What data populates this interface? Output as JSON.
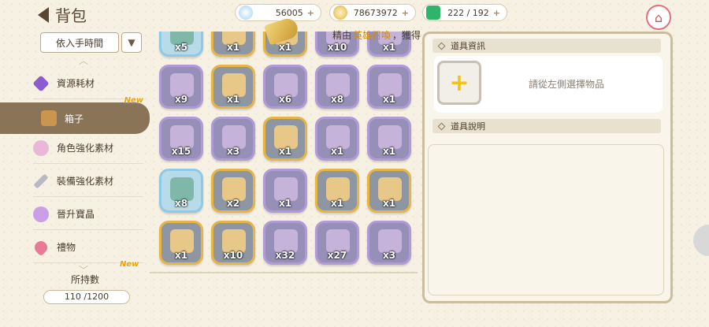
{
  "header": {
    "title": "背包"
  },
  "currencies": [
    {
      "icon": "gem-icon",
      "value": "56005"
    },
    {
      "icon": "coin-icon",
      "value": "78673972"
    },
    {
      "icon": "stamina-icon",
      "value": "222 / 192"
    }
  ],
  "sort": {
    "label": "依入手時間"
  },
  "sidebar": {
    "items": [
      {
        "label": "資源耗材",
        "icon": "crystal-icon",
        "color": "#8b5bd0"
      },
      {
        "label": "箱子",
        "icon": "box-icon",
        "color": "#c9954f",
        "badge": "New"
      },
      {
        "label": "角色強化素材",
        "icon": "character-material-icon",
        "color": "#e9b8d8"
      },
      {
        "label": "裝備強化素材",
        "icon": "sword-icon",
        "color": "#b9b9c4"
      },
      {
        "label": "晉升寶晶",
        "icon": "promotion-crystal-icon",
        "color": "#c9a0e8"
      },
      {
        "label": "禮物",
        "icon": "heart-gift-icon",
        "color": "#e87a98"
      }
    ],
    "new_badge_below": "New",
    "hold_label": "所持數",
    "hold_count": "110 /1200"
  },
  "notice": {
    "part1": "精由",
    "highlight": "英雄召喚",
    "part2": "，獲得"
  },
  "grid": {
    "rows": [
      [
        {
          "qty": "x5",
          "frame": "blue"
        },
        {
          "qty": "x1",
          "frame": "gold"
        },
        {
          "qty": "x1",
          "frame": "gold"
        },
        {
          "qty": "x10",
          "frame": "purple"
        },
        {
          "qty": "x1",
          "frame": "purple"
        }
      ],
      [
        {
          "qty": "x9",
          "frame": "purple"
        },
        {
          "qty": "x1",
          "frame": "gold"
        },
        {
          "qty": "x6",
          "frame": "purple"
        },
        {
          "qty": "x8",
          "frame": "purple"
        },
        {
          "qty": "x1",
          "frame": "purple"
        }
      ],
      [
        {
          "qty": "x15",
          "frame": "purple"
        },
        {
          "qty": "x3",
          "frame": "purple"
        },
        {
          "qty": "x1",
          "frame": "gold"
        },
        {
          "qty": "x1",
          "frame": "purple"
        },
        {
          "qty": "x1",
          "frame": "purple"
        }
      ],
      [
        {
          "qty": "x8",
          "frame": "blue"
        },
        {
          "qty": "x2",
          "frame": "gold"
        },
        {
          "qty": "x1",
          "frame": "purple"
        },
        {
          "qty": "x1",
          "frame": "gold"
        },
        {
          "qty": "x1",
          "frame": "gold"
        }
      ],
      [
        {
          "qty": "x1",
          "frame": "gold"
        },
        {
          "qty": "x10",
          "frame": "gold"
        },
        {
          "qty": "x32",
          "frame": "purple"
        },
        {
          "qty": "x27",
          "frame": "purple"
        },
        {
          "qty": "x3",
          "frame": "purple"
        }
      ]
    ]
  },
  "detail": {
    "info_header": "道具資訊",
    "hint": "請從左側選擇物品",
    "desc_header": "道具說明"
  }
}
